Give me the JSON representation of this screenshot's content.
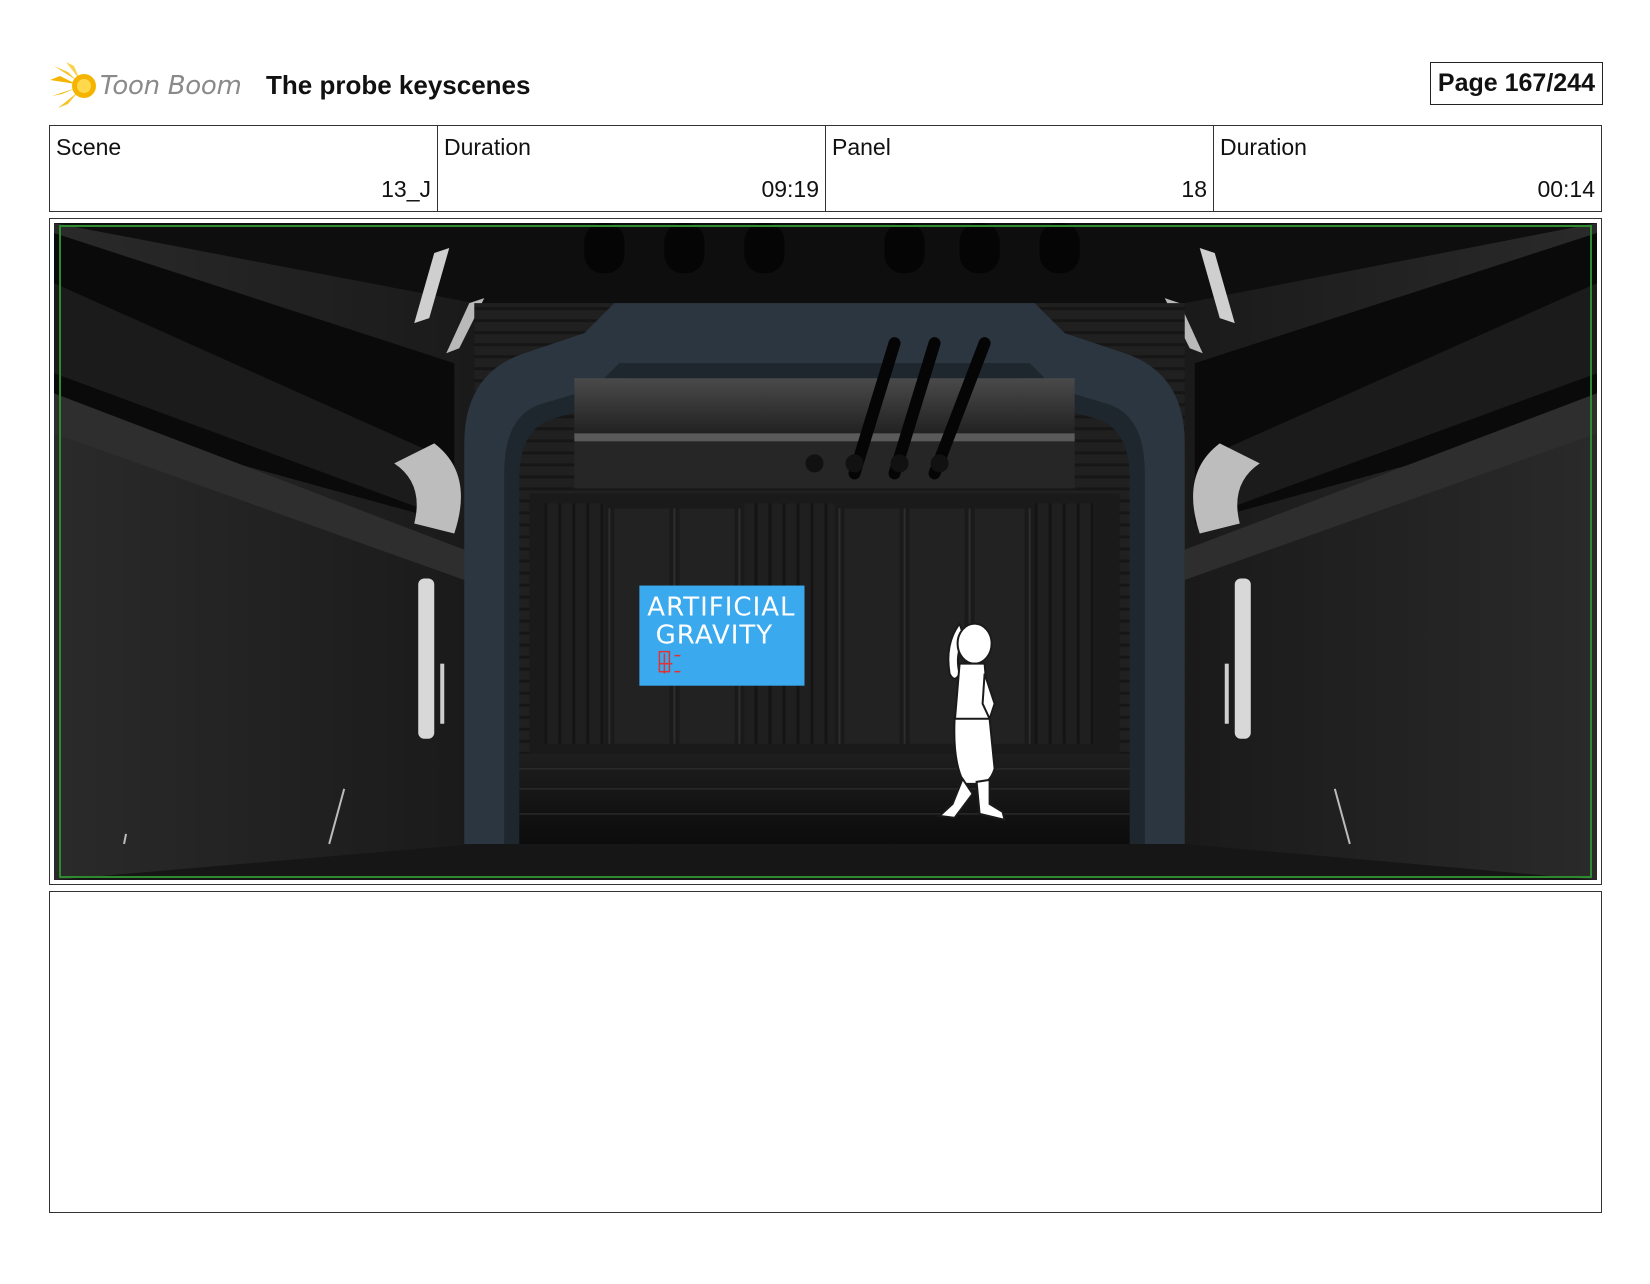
{
  "header": {
    "logo_text": "Toon Boom",
    "title": "The probe keyscenes",
    "page": "Page 167/244"
  },
  "info": {
    "scene_label": "Scene",
    "scene_value": "13_J",
    "scene_duration_label": "Duration",
    "scene_duration_value": "09:19",
    "panel_label": "Panel",
    "panel_value": "18",
    "panel_duration_label": "Duration",
    "panel_duration_value": "00:14"
  },
  "panel": {
    "sign_line1": "ARTIFICIAL",
    "sign_line2": "GRAVITY"
  },
  "colors": {
    "sign_blue": "#3aa9ee",
    "frame_green": "#2e8a2e",
    "logo_yellow": "#f5c518"
  }
}
